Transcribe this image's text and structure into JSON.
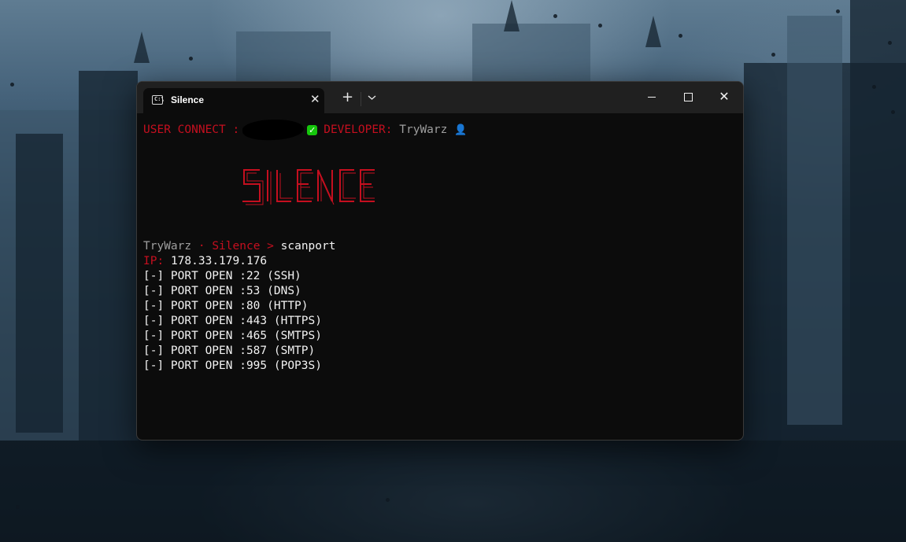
{
  "window": {
    "tab_title": "Silence",
    "tab_icon": "terminal-icon",
    "tab_close_label": "✕",
    "new_tab_label": "+",
    "dropdown_label": "⌄",
    "minimize_icon": "minimize-icon",
    "maximize_icon": "maximize-icon",
    "close_label": "✕"
  },
  "terminal": {
    "header": {
      "user_connect_label": "USER CONNECT :",
      "developer_label": "DEVELOPER:",
      "developer_name": "TryWarz",
      "status_icon": "check-icon",
      "user_icon": "user-icon"
    },
    "banner_text": "SILENCE",
    "prompt": {
      "user": "TryWarz",
      "separator": " · ",
      "app": "Silence",
      "arrow": " > ",
      "command": "scanport"
    },
    "ip": {
      "label": "IP:",
      "value": "178.33.179.176"
    },
    "ports": [
      {
        "text": "[-] PORT OPEN :22 (SSH)"
      },
      {
        "text": "[-] PORT OPEN :53 (DNS)"
      },
      {
        "text": "[-] PORT OPEN :80 (HTTP)"
      },
      {
        "text": "[-] PORT OPEN :443 (HTTPS)"
      },
      {
        "text": "[-] PORT OPEN :465 (SMTPS)"
      },
      {
        "text": "[-] PORT OPEN :587 (SMTP)"
      },
      {
        "text": "[-] PORT OPEN :995 (POP3S)"
      }
    ]
  },
  "colors": {
    "accent_red": "#c50f1f",
    "text_gray": "#9e9e9e",
    "terminal_bg": "#0c0c0c",
    "titlebar_bg": "#202020"
  }
}
